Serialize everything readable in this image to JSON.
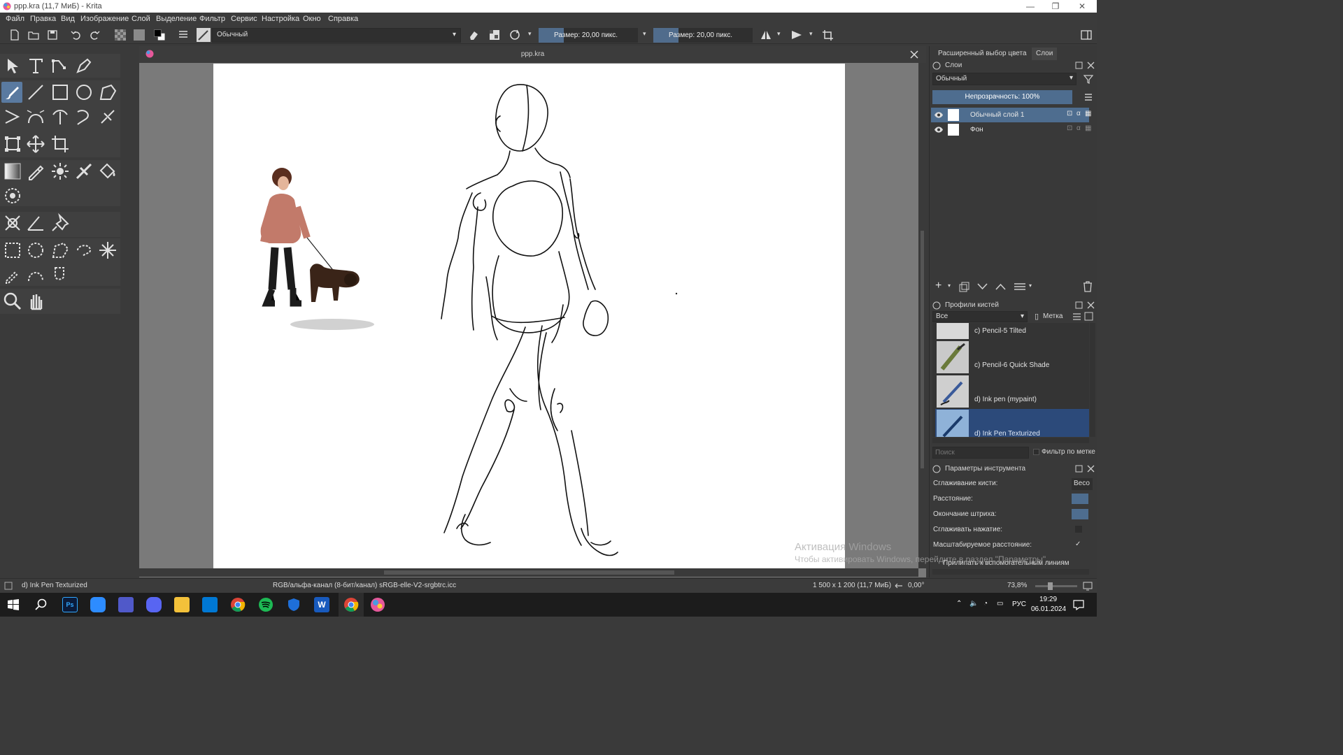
{
  "window": {
    "title": "ppp.kra (11,7 МиБ)  - Krita",
    "minimize": "—",
    "restore": "❐",
    "close": "✕"
  },
  "menu": [
    "Файл",
    "Правка",
    "Вид",
    "Изображение",
    "Слой",
    "Выделение",
    "Фильтр",
    "Сервис",
    "Настройка",
    "Окно",
    "Справка"
  ],
  "toolbar": {
    "blend_mode": "Обычный",
    "size1": "Размер: 20,00 пикс.",
    "size2": "Размер: 20,00 пикс."
  },
  "document": {
    "tab_name": "ppp.kra"
  },
  "dockers": {
    "tabs": [
      "Расширенный выбор цвета",
      "Слои"
    ],
    "layers": {
      "title": "Слои",
      "blend_mode": "Обычный",
      "opacity": "Непрозрачность:  100%",
      "items": [
        {
          "name": "Обычный слой 1",
          "selected": true
        },
        {
          "name": "Фон",
          "selected": false
        }
      ]
    },
    "brush_presets": {
      "title": "Профили кистей",
      "filter": "Все",
      "tag": "Метка",
      "items": [
        {
          "name": "c) Pencil-5 Tilted"
        },
        {
          "name": "c) Pencil-6 Quick Shade"
        },
        {
          "name": "d) Ink pen (mypaint)"
        },
        {
          "name": "d) Ink Pen Texturized"
        }
      ],
      "search_placeholder": "Поиск",
      "filter_by_tag": "Фильтр по метке"
    },
    "tool_options": {
      "title": "Параметры инструмента",
      "rows": [
        {
          "label": "Сглаживание кисти:",
          "value": "Весо"
        },
        {
          "label": "Расстояние:"
        },
        {
          "label": "Окончание штриха:"
        },
        {
          "label": "Сглаживать нажатие:"
        },
        {
          "label": "Масштабируемое расстояние:",
          "value": "✓"
        },
        {
          "label": "Прилипать к вспомогательным линиям"
        }
      ]
    }
  },
  "status": {
    "brush": "d) Ink Pen Texturized",
    "color_model": "RGB/альфа-канал (8-бит/канал)  sRGB-elle-V2-srgbtrc.icc",
    "dimensions": "1 500 x 1 200 (11,7 МиБ)",
    "rotation": "0,00°",
    "zoom": "73,8%"
  },
  "watermark": {
    "line1": "Активация Windows",
    "line2": "Чтобы активировать Windows, перейдите в раздел \"Параметры\"."
  },
  "taskbar": {
    "lang": "РУС",
    "time": "19:29",
    "date": "06.01.2024"
  },
  "colors": {
    "accent": "#4e6d8f",
    "selected_brush": "#2c4a7a",
    "paper": "#ffffff",
    "canvas_bg": "#7a7a7a"
  }
}
